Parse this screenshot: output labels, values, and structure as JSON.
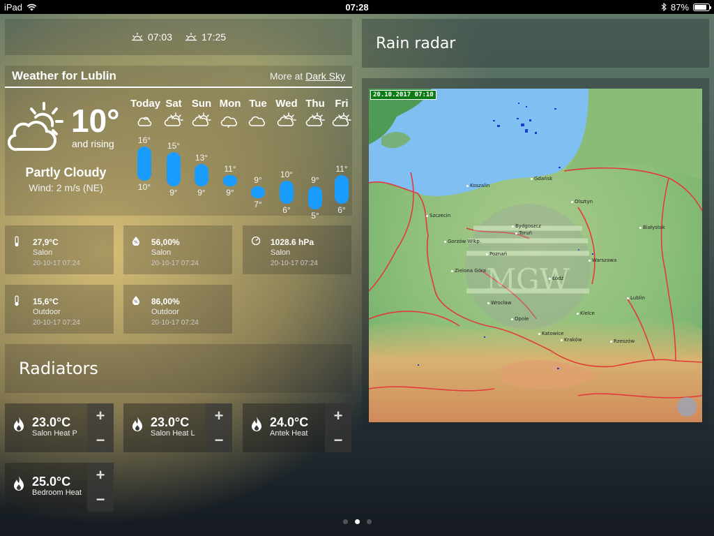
{
  "status_bar": {
    "device": "iPad",
    "time": "07:28",
    "battery": "87%",
    "battery_level": 0.87
  },
  "sun": {
    "sunrise": "07:03",
    "sunset": "17:25"
  },
  "weather": {
    "title": "Weather for Lublin",
    "more_prefix": "More at",
    "more_link": "Dark Sky",
    "current_temp": "10°",
    "trend": "and rising",
    "condition": "Partly Cloudy",
    "wind": "Wind: 2 m/s (NE)",
    "forecast": [
      {
        "day": "Today",
        "icon": "partly-cloudy-icon",
        "high": "16°",
        "low": "10°",
        "high_value": 16,
        "low_value": 10
      },
      {
        "day": "Sat",
        "icon": "partly-cloudy-day-icon",
        "high": "15°",
        "low": "9°",
        "high_value": 15,
        "low_value": 9
      },
      {
        "day": "Sun",
        "icon": "partly-cloudy-day-icon",
        "high": "13°",
        "low": "9°",
        "high_value": 13,
        "low_value": 9
      },
      {
        "day": "Mon",
        "icon": "rain-cloud-icon",
        "high": "11°",
        "low": "9°",
        "high_value": 11,
        "low_value": 9
      },
      {
        "day": "Tue",
        "icon": "cloud-icon",
        "high": "9°",
        "low": "7°",
        "high_value": 9,
        "low_value": 7
      },
      {
        "day": "Wed",
        "icon": "partly-cloudy-day-icon",
        "high": "10°",
        "low": "6°",
        "high_value": 10,
        "low_value": 6
      },
      {
        "day": "Thu",
        "icon": "partly-cloudy-day-icon",
        "high": "9°",
        "low": "5°",
        "high_value": 9,
        "low_value": 5
      },
      {
        "day": "Fri",
        "icon": "partly-cloudy-day-icon",
        "high": "11°",
        "low": "6°",
        "high_value": 11,
        "low_value": 6
      }
    ]
  },
  "sensors": [
    {
      "icon": "thermometer-icon",
      "value": "27,9°C",
      "name": "Salon",
      "time": "20-10-17 07:24"
    },
    {
      "icon": "humidity-icon",
      "value": "56,00%",
      "name": "Salon",
      "time": "20-10-17 07:24"
    },
    {
      "icon": "barometer-icon",
      "value": "1028.6 hPa",
      "name": "Salon",
      "time": "20-10-17 07:24"
    },
    {
      "icon": "thermometer-icon",
      "value": "15,6°C",
      "name": "Outdoor",
      "time": "20-10-17 07:24"
    },
    {
      "icon": "humidity-icon",
      "value": "86,00%",
      "name": "Outdoor",
      "time": "20-10-17 07:24"
    }
  ],
  "radiators": {
    "title": "Radiators",
    "plus": "+",
    "minus": "−",
    "items": [
      {
        "temp": "23.0°C",
        "name": "Salon Heat P"
      },
      {
        "temp": "23.0°C",
        "name": "Salon Heat L"
      },
      {
        "temp": "24.0°C",
        "name": "Antek Heat"
      },
      {
        "temp": "25.0°C",
        "name": "Bedroom Heat"
      }
    ]
  },
  "radar": {
    "title": "Rain radar",
    "timestamp": "20.10.2017 07:10",
    "cities": [
      "Koszalin",
      "Gdańsk",
      "Olsztyn",
      "Szczecin",
      "Bydgoszcz",
      "Toruń",
      "Białystok",
      "Gorzów Wlkp.",
      "Poznań",
      "Warszawa",
      "Zielona Góra",
      "Łódź",
      "Wrocław",
      "Lublin",
      "Opole",
      "Kielce",
      "Katowice",
      "Kraków",
      "Rzeszów"
    ],
    "watermark": "IMGW"
  },
  "pager": {
    "pages": 3,
    "active": 2
  },
  "colors": {
    "rain_bar": "#1a9cff",
    "sea": "#7fbff2",
    "border": "#e23a3a"
  }
}
